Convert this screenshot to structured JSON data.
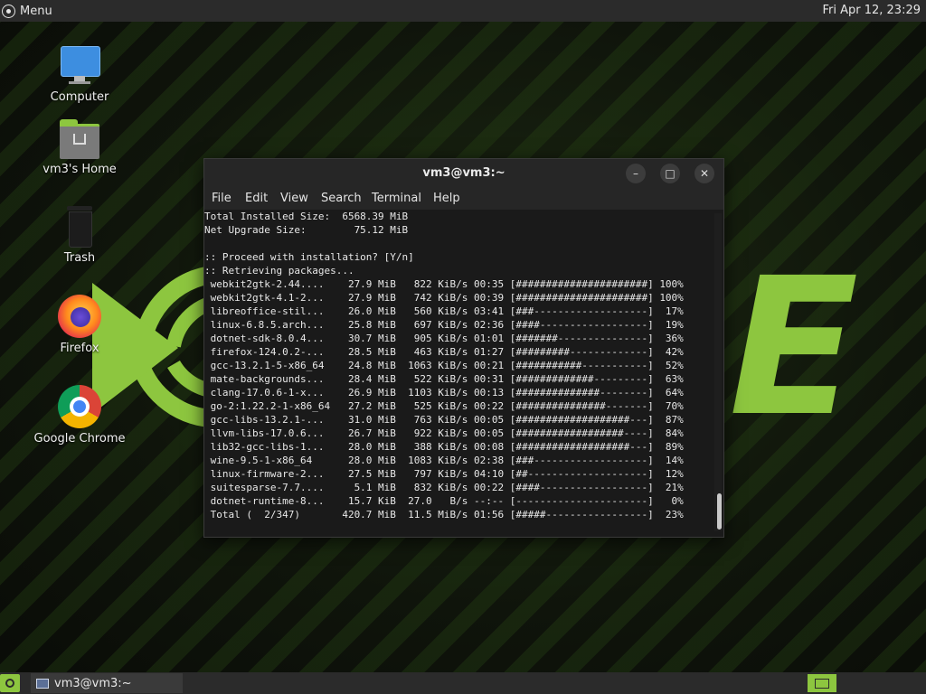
{
  "top_panel": {
    "menu_label": "Menu",
    "clock": "Fri Apr 12, 23:29"
  },
  "desktop": {
    "icons": [
      {
        "label": "Computer",
        "icon": "computer-monitor-icon"
      },
      {
        "label": "vm3's Home",
        "icon": "home-folder-icon"
      },
      {
        "label": "Trash",
        "icon": "trash-icon"
      },
      {
        "label": "Firefox",
        "icon": "firefox-icon"
      },
      {
        "label": "Google Chrome",
        "icon": "chrome-icon"
      }
    ]
  },
  "terminal": {
    "title": "vm3@vm3:~",
    "buttons": {
      "minimize": "–",
      "maximize": "□",
      "close": "✕"
    },
    "menu": [
      "File",
      "Edit",
      "View",
      "Search",
      "Terminal",
      "Help"
    ],
    "lines": [
      "Total Installed Size:  6568.39 MiB",
      "Net Upgrade Size:        75.12 MiB",
      "",
      ":: Proceed with installation? [Y/n]",
      ":: Retrieving packages...",
      " webkit2gtk-2.44....    27.9 MiB   822 KiB/s 00:35 [######################] 100%",
      " webkit2gtk-4.1-2...    27.9 MiB   742 KiB/s 00:39 [######################] 100%",
      " libreoffice-stil...    26.0 MiB   560 KiB/s 03:41 [###-------------------]  17%",
      " linux-6.8.5.arch...    25.8 MiB   697 KiB/s 02:36 [####------------------]  19%",
      " dotnet-sdk-8.0.4...    30.7 MiB   905 KiB/s 01:01 [#######---------------]  36%",
      " firefox-124.0.2-...    28.5 MiB   463 KiB/s 01:27 [#########-------------]  42%",
      " gcc-13.2.1-5-x86_64    24.8 MiB  1063 KiB/s 00:21 [###########-----------]  52%",
      " mate-backgrounds...    28.4 MiB   522 KiB/s 00:31 [#############---------]  63%",
      " clang-17.0.6-1-x...    26.9 MiB  1103 KiB/s 00:13 [##############--------]  64%",
      " go-2:1.22.2-1-x86_64   27.2 MiB   525 KiB/s 00:22 [###############-------]  70%",
      " gcc-libs-13.2.1-...    31.0 MiB   763 KiB/s 00:05 [###################---]  87%",
      " llvm-libs-17.0.6...    26.7 MiB   922 KiB/s 00:05 [##################----]  84%",
      " lib32-gcc-libs-1...    28.0 MiB   388 KiB/s 00:08 [###################---]  89%",
      " wine-9.5-1-x86_64      28.0 MiB  1083 KiB/s 02:38 [###-------------------]  14%",
      " linux-firmware-2...    27.5 MiB   797 KiB/s 04:10 [##--------------------]  12%",
      " suitesparse-7.7....     5.1 MiB   832 KiB/s 00:22 [####------------------]  21%",
      " dotnet-runtime-8...    15.7 KiB  27.0   B/s --:-- [----------------------]   0%",
      " Total (  2/347)       420.7 MiB  11.5 MiB/s 01:56 [#####-----------------]  23%"
    ]
  },
  "taskbar": {
    "window_label": "vm3@vm3:~"
  },
  "colors": {
    "accent": "#8dc63f",
    "panel": "#2b2b2b",
    "terminal_bg": "#1a1a1a"
  }
}
